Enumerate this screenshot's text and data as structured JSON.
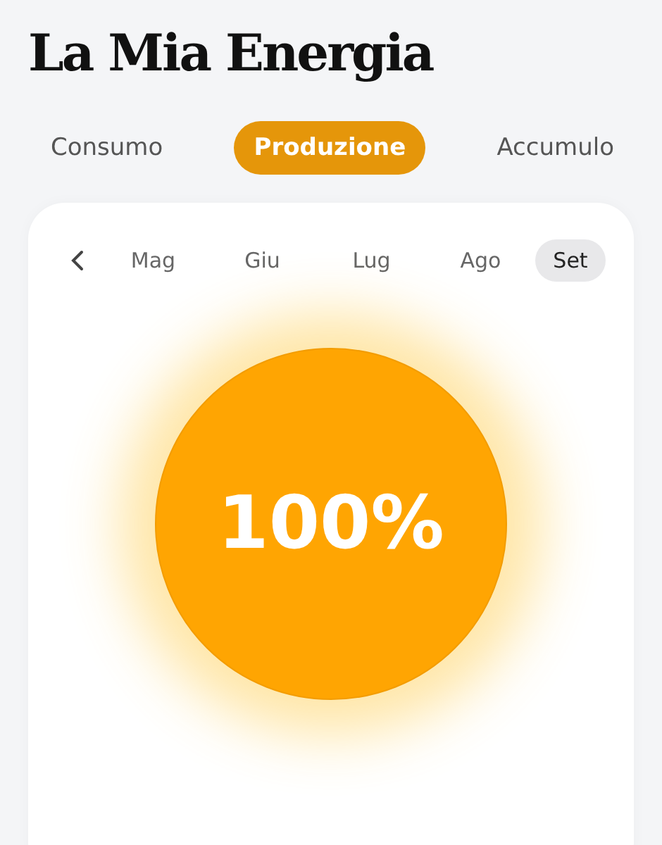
{
  "title": "La Mia Energia",
  "tabs": [
    {
      "label": "Consumo",
      "selected": false
    },
    {
      "label": "Produzione",
      "selected": true
    },
    {
      "label": "Accumulo",
      "selected": false
    }
  ],
  "months": [
    {
      "label": "Mag",
      "selected": false
    },
    {
      "label": "Giu",
      "selected": false
    },
    {
      "label": "Lug",
      "selected": false
    },
    {
      "label": "Ago",
      "selected": false
    },
    {
      "label": "Set",
      "selected": true
    }
  ],
  "gauge": {
    "value": "100%"
  }
}
